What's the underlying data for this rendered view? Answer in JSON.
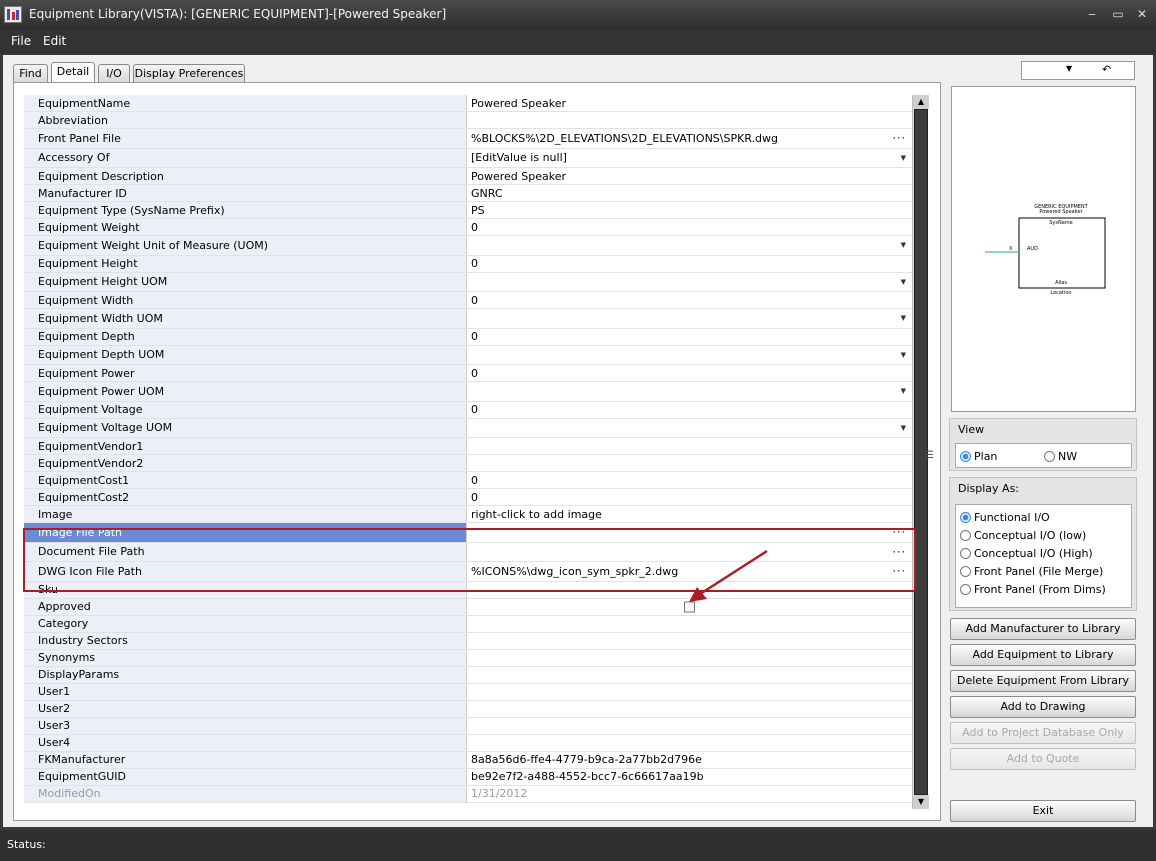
{
  "window": {
    "title": "Equipment Library(VISTA): [GENERIC EQUIPMENT]-[Powered Speaker]",
    "app_icon": "equipment-library-icon",
    "controls": [
      "minimize-icon",
      "maximize-icon",
      "close-icon"
    ],
    "minimize_glyph": "‒",
    "maximize_glyph": "▭",
    "close_glyph": "✕"
  },
  "menu": {
    "items": [
      {
        "label": "File"
      },
      {
        "label": "Edit"
      }
    ]
  },
  "tabs": [
    {
      "label": "Find",
      "active": false
    },
    {
      "label": "Detail",
      "active": true
    },
    {
      "label": "I/O",
      "active": false
    },
    {
      "label": "Display Preferences",
      "active": false
    }
  ],
  "grid": {
    "ellipsis": "···",
    "dropdown": "▼",
    "rows": [
      {
        "label": "EquipmentName",
        "value": "Powered Speaker",
        "editor": ""
      },
      {
        "label": "Abbreviation",
        "value": "",
        "editor": ""
      },
      {
        "label": "Front Panel File",
        "value": "%BLOCKS%\\2D_ELEVATIONS\\2D_ELEVATIONS\\SPKR.dwg",
        "editor": "ellipsis"
      },
      {
        "label": "Accessory Of",
        "value": "[EditValue is null]",
        "editor": "dropdown"
      },
      {
        "label": "Equipment Description",
        "value": "Powered Speaker",
        "editor": ""
      },
      {
        "label": "Manufacturer ID",
        "value": "GNRC",
        "editor": ""
      },
      {
        "label": "Equipment Type (SysName Prefix)",
        "value": "PS",
        "editor": ""
      },
      {
        "label": "Equipment Weight",
        "value": "0",
        "editor": ""
      },
      {
        "label": "Equipment Weight Unit of Measure (UOM)",
        "value": "",
        "editor": "dropdown"
      },
      {
        "label": "Equipment Height",
        "value": "0",
        "editor": ""
      },
      {
        "label": "Equipment Height UOM",
        "value": "",
        "editor": "dropdown"
      },
      {
        "label": "Equipment Width",
        "value": "0",
        "editor": ""
      },
      {
        "label": "Equipment Width UOM",
        "value": "",
        "editor": "dropdown"
      },
      {
        "label": "Equipment Depth",
        "value": "0",
        "editor": ""
      },
      {
        "label": "Equipment Depth UOM",
        "value": "",
        "editor": "dropdown"
      },
      {
        "label": "Equipment Power",
        "value": "0",
        "editor": ""
      },
      {
        "label": "Equipment Power UOM",
        "value": "",
        "editor": "dropdown"
      },
      {
        "label": "Equipment Voltage",
        "value": "0",
        "editor": ""
      },
      {
        "label": "Equipment Voltage UOM",
        "value": "",
        "editor": "dropdown"
      },
      {
        "label": "EquipmentVendor1",
        "value": "",
        "editor": ""
      },
      {
        "label": "EquipmentVendor2",
        "value": "",
        "editor": ""
      },
      {
        "label": "EquipmentCost1",
        "value": "0",
        "editor": ""
      },
      {
        "label": "EquipmentCost2",
        "value": "0",
        "editor": ""
      },
      {
        "label": "Image",
        "value": "right-click to add image",
        "editor": ""
      },
      {
        "label": "Image File Path",
        "value": "",
        "editor": "ellipsis",
        "selected": true
      },
      {
        "label": "Document File Path",
        "value": "",
        "editor": "ellipsis"
      },
      {
        "label": "DWG Icon File Path",
        "value": "%ICONS%\\dwg_icon_sym_spkr_2.dwg",
        "editor": "ellipsis"
      },
      {
        "label": "Sku",
        "value": "",
        "editor": ""
      },
      {
        "label": "Approved",
        "value": "",
        "editor": "checkbox",
        "checked": false
      },
      {
        "label": "Category",
        "value": "",
        "editor": ""
      },
      {
        "label": "Industry Sectors",
        "value": "",
        "editor": ""
      },
      {
        "label": "Synonyms",
        "value": "",
        "editor": ""
      },
      {
        "label": "DisplayParams",
        "value": "",
        "editor": ""
      },
      {
        "label": "User1",
        "value": "",
        "editor": ""
      },
      {
        "label": "User2",
        "value": "",
        "editor": ""
      },
      {
        "label": "User3",
        "value": "",
        "editor": ""
      },
      {
        "label": "User4",
        "value": "",
        "editor": ""
      },
      {
        "label": "FKManufacturer",
        "value": "8a8a56d6-ffe4-4779-b9ca-2a77bb2d796e",
        "editor": ""
      },
      {
        "label": "EquipmentGUID",
        "value": "be92e7f2-a488-4552-bcc7-6c66617aa19b",
        "editor": ""
      },
      {
        "label": "ModifiedOn",
        "value": "1/31/2012",
        "editor": "",
        "disabled": true
      }
    ]
  },
  "preview": {
    "header_line1": "GENERIC EQUIPMENT",
    "header_line2": "Powered Speaker",
    "sysname": "SysName",
    "port": "AUD",
    "port_marker": "X",
    "alias": "Alias",
    "location": "Location",
    "combo_icon": "chevron-down-icon",
    "refresh_icon": "refresh-icon",
    "combo_glyph": "▼",
    "refresh_glyph": "↶"
  },
  "view_group": {
    "title": "View",
    "options": [
      {
        "label": "Plan",
        "checked": true
      },
      {
        "label": "NW",
        "checked": false
      }
    ]
  },
  "display_as_group": {
    "title": "Display As:",
    "options": [
      {
        "label": "Functional I/O",
        "checked": true
      },
      {
        "label": "Conceptual I/O (low)",
        "checked": false
      },
      {
        "label": "Conceptual I/O (High)",
        "checked": false
      },
      {
        "label": "Front Panel (File Merge)",
        "checked": false
      },
      {
        "label": "Front Panel (From Dims)",
        "checked": false
      }
    ]
  },
  "buttons": {
    "add_manufacturer": {
      "label": "Add Manufacturer to Library",
      "enabled": true
    },
    "add_equipment": {
      "label": "Add Equipment to Library",
      "enabled": true
    },
    "delete_equipment": {
      "label": "Delete Equipment From Library",
      "enabled": true
    },
    "add_to_drawing": {
      "label": "Add to Drawing",
      "enabled": true
    },
    "add_to_project_db": {
      "label": "Add to Project Database Only",
      "enabled": false
    },
    "add_to_quote": {
      "label": "Add to Quote",
      "enabled": false
    },
    "exit": {
      "label": "Exit",
      "enabled": true
    }
  },
  "status": {
    "label": "Status:"
  },
  "colors": {
    "highlight_box": "#a81e24",
    "selected_row": "#6b8bd6",
    "preview_line": "#22b24c"
  }
}
